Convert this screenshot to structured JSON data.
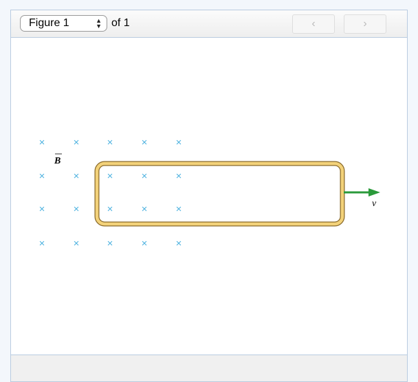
{
  "toolbar": {
    "figure_select": "Figure 1",
    "of_label": "of 1",
    "prev_icon": "chevron-left-icon",
    "next_icon": "chevron-right-icon"
  },
  "figure": {
    "field_label": "B",
    "velocity_label": "v",
    "field_symbol": "×",
    "colors": {
      "field": "#4fb3e0",
      "loop": "#f3d27a",
      "arrow": "#2a9a3a"
    }
  }
}
